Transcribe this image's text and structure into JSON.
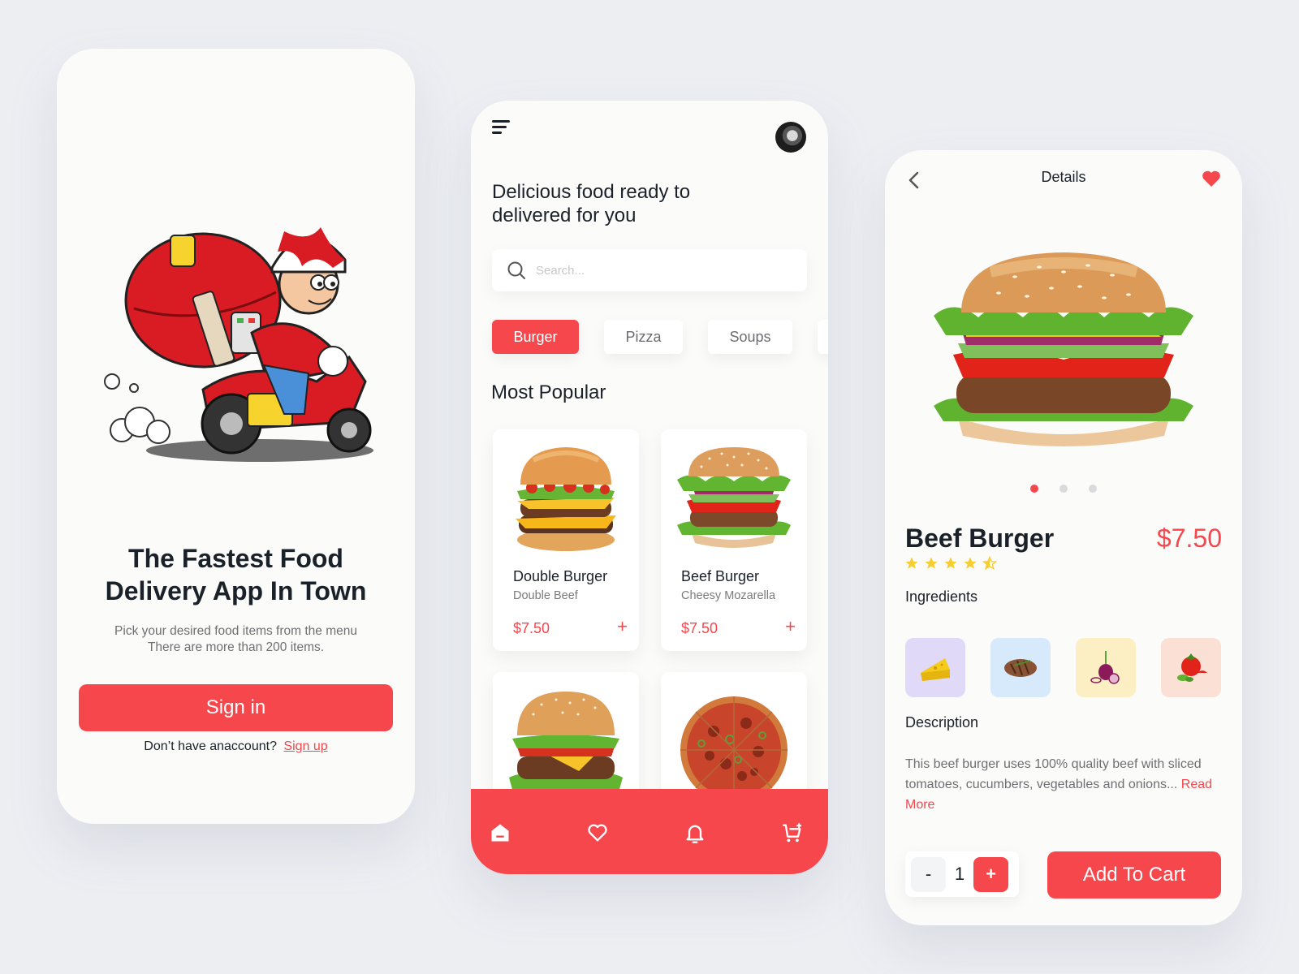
{
  "welcome": {
    "title_line1": "The Fastest Food",
    "title_line2": "Delivery App In Town",
    "subtitle_line1": "Pick your desired food items from the menu",
    "subtitle_line2": "There are more than 200 items.",
    "signin_label": "Sign in",
    "no_account_text": "Don’t have anaccount?",
    "signup_label": "Sign up",
    "illustration": "delivery-rider-scooter-illustration"
  },
  "home": {
    "menu_icon": "menu-icon",
    "avatar": "user-avatar",
    "headline_line1": "Delicious food ready to",
    "headline_line2": "delivered for you",
    "search": {
      "placeholder": "Search...",
      "value": ""
    },
    "categories": [
      {
        "label": "Burger",
        "active": true
      },
      {
        "label": "Pizza",
        "active": false
      },
      {
        "label": "Soups",
        "active": false
      },
      {
        "label": "",
        "active": false
      }
    ],
    "section_title": "Most Popular",
    "items": [
      {
        "name": "Double Burger",
        "description": "Double Beef",
        "price": "$7.50",
        "image": "double-burger"
      },
      {
        "name": "Beef Burger",
        "description": "Cheesy Mozarella",
        "price": "$7.50",
        "image": "beef-burger"
      },
      {
        "name": "",
        "description": "",
        "price": "",
        "image": "cheese-burger"
      },
      {
        "name": "",
        "description": "",
        "price": "",
        "image": "pizza"
      }
    ],
    "add_label": "+",
    "nav": [
      "home",
      "favorites",
      "notifications",
      "cart"
    ]
  },
  "details": {
    "title": "Details",
    "product_name": "Beef Burger",
    "price": "$7.50",
    "rating": 4.5,
    "rating_max": 5,
    "carousel": {
      "count": 3,
      "active": 0
    },
    "ingredients_label": "Ingredients",
    "ingredients": [
      {
        "name": "cheese",
        "bg": "#e0d9f7"
      },
      {
        "name": "steak",
        "bg": "#d6eafb"
      },
      {
        "name": "onion",
        "bg": "#fcefc4"
      },
      {
        "name": "tomato",
        "bg": "#fbe0d6"
      }
    ],
    "description_label": "Description",
    "description": "This beef burger uses 100% quality beef with sliced tomatoes, cucumbers, vegetables and onions...",
    "read_more": "Read More",
    "quantity": "1",
    "minus_label": "-",
    "plus_label": "+",
    "add_to_cart_label": "Add To Cart"
  },
  "colors": {
    "accent": "#f6474d",
    "background": "#eceef2",
    "screen": "#fbfbfa",
    "text": "#1b2129",
    "muted": "#6e6f72",
    "star": "#f8cd2f"
  }
}
